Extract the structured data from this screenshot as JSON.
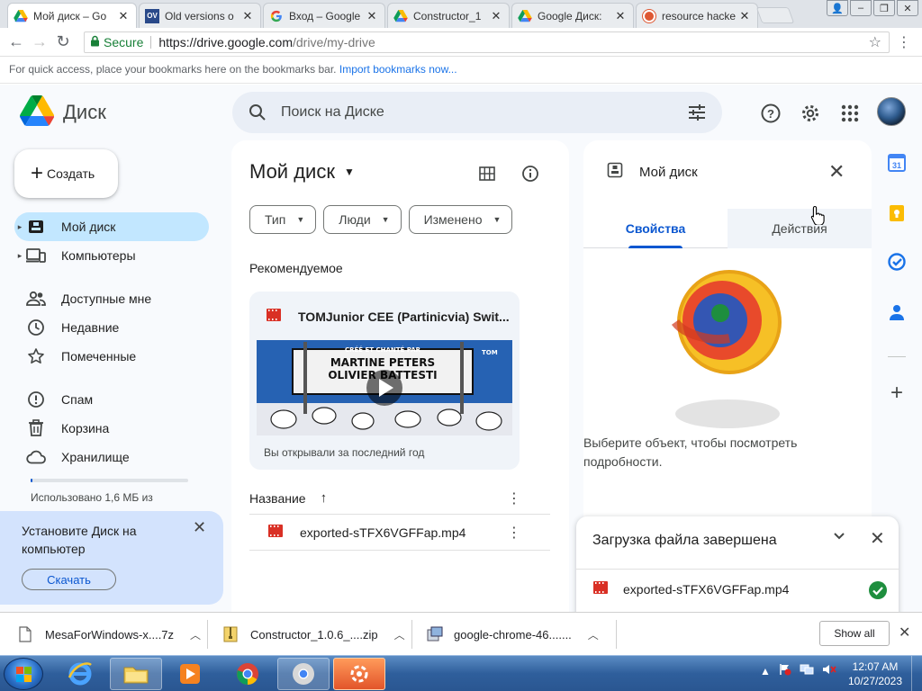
{
  "browser": {
    "tabs": [
      {
        "title": "Мой диск – Go",
        "icon": "google-drive-icon",
        "active": true
      },
      {
        "title": "Old versions o",
        "icon": "oldversion-icon",
        "active": false
      },
      {
        "title": "Вход – Google",
        "icon": "google-g-icon",
        "active": false
      },
      {
        "title": "Constructor_1",
        "icon": "google-drive-icon",
        "active": false
      },
      {
        "title": "Google Диск: ",
        "icon": "google-drive-icon",
        "active": false
      },
      {
        "title": "resource hacke",
        "icon": "duckduckgo-icon",
        "active": false
      }
    ],
    "secure_label": "Secure",
    "url_host": "https://drive.google.com",
    "url_path": "/drive/my-drive",
    "bookmarks_hint": "For quick access, place your bookmarks here on the bookmarks bar.",
    "bookmarks_link": "Import bookmarks now..."
  },
  "drive": {
    "app_name": "Диск",
    "search_placeholder": "Поиск на Диске",
    "create_label": "Создать",
    "sidebar": [
      {
        "label": "Мой диск",
        "icon": "my-drive-icon",
        "active": true,
        "expand": true
      },
      {
        "label": "Компьютеры",
        "icon": "computers-icon",
        "active": false,
        "expand": true
      },
      {
        "label": "Доступные мне",
        "icon": "shared-icon",
        "active": false
      },
      {
        "label": "Недавние",
        "icon": "clock-icon",
        "active": false
      },
      {
        "label": "Помеченные",
        "icon": "star-icon",
        "active": false
      },
      {
        "label": "Спам",
        "icon": "spam-icon",
        "active": false
      },
      {
        "label": "Корзина",
        "icon": "trash-icon",
        "active": false
      },
      {
        "label": "Хранилище",
        "icon": "cloud-icon",
        "active": false
      }
    ],
    "storage_text": "Использовано 1,6 МБ из",
    "promo": {
      "text": "Установите Диск на компьютер",
      "button": "Скачать"
    },
    "main": {
      "title": "Мой диск",
      "filters": [
        "Тип",
        "Люди",
        "Изменено"
      ],
      "section_label": "Рекомендуемое",
      "recommended": {
        "title": "TOMJunior CEE (Partinicvia) Swit...",
        "subtitle": "Вы открывали за последний год",
        "thumb_line1": "CRÉÉ ET CHANTÉ PAR",
        "thumb_line2": "MARTINE PETERS",
        "thumb_line3": "OLIVIER BATTESTI",
        "thumb_badge": "TOM"
      },
      "list_header": "Название",
      "files": [
        {
          "name": "exported-sTFX6VGFFap.mp4"
        }
      ]
    },
    "details": {
      "title": "Мой диск",
      "tab_properties": "Свойства",
      "tab_actions": "Действия",
      "empty_text": "Выберите объект, чтобы посмотреть подробности."
    },
    "upload": {
      "title": "Загрузка файла завершена",
      "file": "exported-sTFX6VGFFap.mp4"
    }
  },
  "downloads": [
    {
      "name": "MesaForWindows-x....7z",
      "icon": "file-icon"
    },
    {
      "name": "Constructor_1.0.6_....zip",
      "icon": "zip-icon"
    },
    {
      "name": "google-chrome-46.......",
      "icon": "installer-icon"
    }
  ],
  "downloads_show_all": "Show all",
  "taskbar": {
    "time": "12:07 AM",
    "date": "10/27/2023"
  },
  "colors": {
    "accent": "#0b57d0",
    "active_nav": "#c2e7ff",
    "video_red": "#d93025",
    "success_green": "#1e8e3e"
  }
}
